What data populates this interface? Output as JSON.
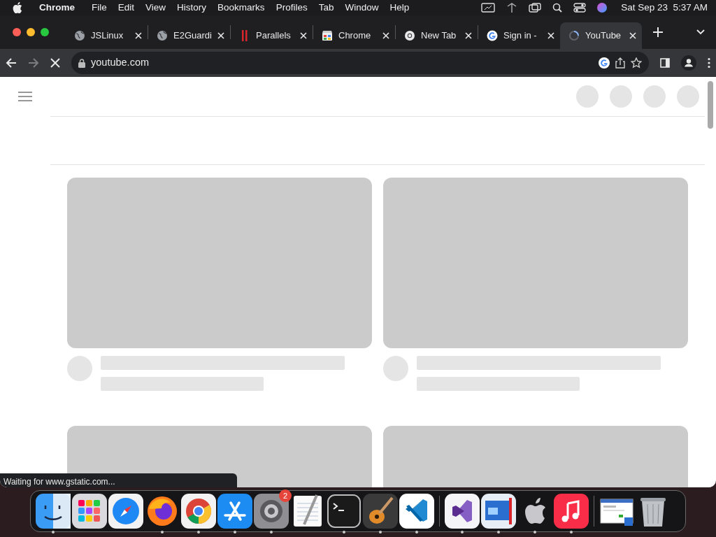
{
  "menu_bar": {
    "app": "Chrome",
    "menus": [
      "File",
      "Edit",
      "View",
      "History",
      "Bookmarks",
      "Profiles",
      "Tab",
      "Window",
      "Help"
    ],
    "clock": "Sat Sep 23  5:37 AM"
  },
  "tabs": [
    {
      "title": "JSLinux",
      "kind": "globe",
      "selected": false
    },
    {
      "title": "E2Guardi",
      "kind": "globe",
      "selected": false
    },
    {
      "title": "Parallels",
      "kind": "parallels",
      "selected": false
    },
    {
      "title": "Chrome",
      "kind": "store",
      "selected": false
    },
    {
      "title": "New Tab",
      "kind": "chrome",
      "selected": false
    },
    {
      "title": "Sign in -",
      "kind": "google",
      "selected": false
    },
    {
      "title": "YouTube",
      "kind": "loading",
      "selected": true
    }
  ],
  "toolbar": {
    "url": "youtube.com",
    "forward_disabled": true,
    "loading": true
  },
  "page": {
    "header_buttons": [
      {
        "kind": "placeholder"
      },
      {
        "kind": "placeholder"
      },
      {
        "kind": "placeholder"
      },
      {
        "kind": "placeholder"
      }
    ],
    "feed": [
      {
        "kind": "video"
      },
      {
        "kind": "video"
      },
      {
        "kind": "thumbnail"
      },
      {
        "kind": "thumbnail"
      }
    ]
  },
  "status_text": "Waiting for www.gstatic.com...",
  "dock": [
    {
      "kind": "finder",
      "running": true
    },
    {
      "kind": "launchpad",
      "running": false
    },
    {
      "kind": "safari",
      "running": false
    },
    {
      "kind": "firefox",
      "running": true
    },
    {
      "kind": "chrome",
      "running": true
    },
    {
      "kind": "appstore",
      "running": true
    },
    {
      "kind": "settings",
      "running": true,
      "badge": "2"
    },
    {
      "kind": "textedit",
      "running": false
    },
    {
      "kind": "terminal",
      "running": true
    },
    {
      "kind": "guitar",
      "running": true
    },
    {
      "kind": "vscode",
      "running": true
    },
    {
      "kind": "separator"
    },
    {
      "kind": "vs",
      "running": true
    },
    {
      "kind": "parallels",
      "running": true
    },
    {
      "kind": "apple",
      "running": true
    },
    {
      "kind": "music",
      "running": true
    },
    {
      "kind": "separator"
    },
    {
      "kind": "window",
      "running": false
    },
    {
      "kind": "trash",
      "running": false
    }
  ]
}
